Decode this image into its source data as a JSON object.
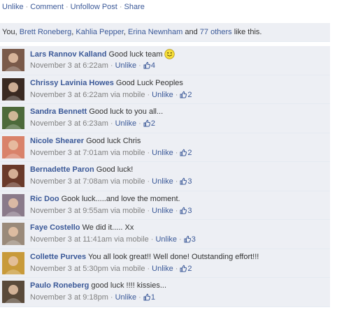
{
  "actions": {
    "unlike": "Unlike",
    "comment": "Comment",
    "unfollow": "Unfollow Post",
    "share": "Share",
    "separator": "·"
  },
  "likes": {
    "prefix": "You,",
    "name1": "Brett Roneberg",
    "name2": "Kahlia Pepper",
    "name3": "Erina Newnham",
    "and": "and",
    "others": "77 others",
    "suffix": "like this."
  },
  "comments": [
    {
      "author": "Lars Rannov Kalland",
      "text": "Good luck team",
      "emoji": "smiley-icon",
      "time": "November 3 at 6:22am",
      "via": "",
      "unlike": "Unlike",
      "likes": "4",
      "avatar_color": "#7a5a4a"
    },
    {
      "author": "Chrissy Lavinia Howes",
      "text": "Good Luck Peoples",
      "emoji": "",
      "time": "November 3 at 6:22am",
      "via": "via mobile",
      "unlike": "Unlike",
      "likes": "2",
      "avatar_color": "#3a2a22"
    },
    {
      "author": "Sandra Bennett",
      "text": "Good luck to you all...",
      "emoji": "",
      "time": "November 3 at 6:23am",
      "via": "",
      "unlike": "Unlike",
      "likes": "2",
      "avatar_color": "#4d6a3a"
    },
    {
      "author": "Nicole Shearer",
      "text": "Good luck Chris",
      "emoji": "",
      "time": "November 3 at 7:01am",
      "via": "via mobile",
      "unlike": "Unlike",
      "likes": "2",
      "avatar_color": "#d9826a"
    },
    {
      "author": "Bernadette Paron",
      "text": "Good luck!",
      "emoji": "",
      "time": "November 3 at 7:08am",
      "via": "via mobile",
      "unlike": "Unlike",
      "likes": "3",
      "avatar_color": "#6a3a2a"
    },
    {
      "author": "Ric Doo",
      "text": "Gook luck.....and love the moment.",
      "emoji": "",
      "time": "November 3 at 9:55am",
      "via": "via mobile",
      "unlike": "Unlike",
      "likes": "3",
      "avatar_color": "#8a7a8a"
    },
    {
      "author": "Faye Costello",
      "text": "We did it..... Xx",
      "emoji": "",
      "time": "November 3 at 11:41am",
      "via": "via mobile",
      "unlike": "Unlike",
      "likes": "3",
      "avatar_color": "#9a8a7a"
    },
    {
      "author": "Collette Purves",
      "text": "You all look great!! Well done! Outstanding effort!!!",
      "emoji": "",
      "time": "November 3 at 5:30pm",
      "via": "via mobile",
      "unlike": "Unlike",
      "likes": "2",
      "avatar_color": "#c89a3a"
    },
    {
      "author": "Paulo Roneberg",
      "text": "good luck !!!! kissies...",
      "emoji": "",
      "time": "November 3 at 9:18pm",
      "via": "",
      "unlike": "Unlike",
      "likes": "1",
      "avatar_color": "#5a4a3a"
    }
  ]
}
